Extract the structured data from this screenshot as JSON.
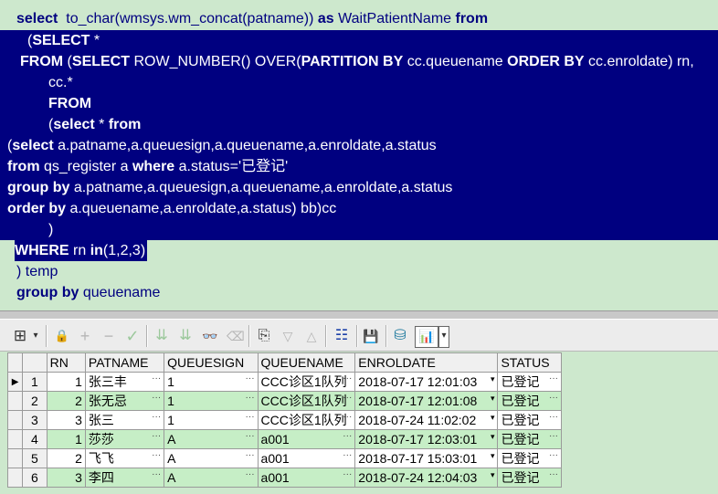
{
  "sql": {
    "l1": {
      "kw1": "select",
      "t1": "  to_char(wmsys.wm_concat(patname)) ",
      "kw2": "as",
      "t2": " WaitPatientName ",
      "kw3": "from"
    },
    "l2": {
      "t0": "(",
      "kw1": "SELECT",
      "t1": " *"
    },
    "l3": {
      "kw1": "FROM",
      "t1": " (",
      "kw2": "SELECT",
      "t2": " ROW_NUMBER() OVER(",
      "kw3": "PARTITION BY",
      "t3": " cc.queuename ",
      "kw4": "ORDER BY",
      "t4": " cc.enroldate) rn,"
    },
    "l4": {
      "t1": "cc.*"
    },
    "l5": {
      "kw1": "FROM"
    },
    "l6": {
      "t1": "(",
      "kw1": "select",
      "t2": " * ",
      "kw2": "from"
    },
    "l7": {
      "t0": "(",
      "kw1": "select",
      "t1": " a.patname,a.queuesign,a.queuename,a.enroldate,a.status"
    },
    "l8": {
      "kw1": "from",
      "t1": " qs_register a ",
      "kw2": "where",
      "t2": " a.status=",
      "s1": "'已登记'"
    },
    "l9": {
      "kw1": "group by",
      "t1": " a.patname,a.queuesign,a.queuename,a.enroldate,a.status"
    },
    "l10": {
      "kw1": "order by",
      "t1": " a.queuename,a.enroldate,a.status) bb)cc"
    },
    "l11": {
      "t1": ")"
    },
    "l12": {
      "kw1": "WHERE",
      "t1": " rn ",
      "kw2": "in",
      "t2": "(1,2,3)"
    },
    "l13": {
      "t1": ") temp"
    },
    "l14": {
      "kw1": "group by",
      "t1": " queuename"
    }
  },
  "grid": {
    "columns": [
      "RN",
      "PATNAME",
      "QUEUESIGN",
      "QUEUENAME",
      "ENROLDATE",
      "STATUS"
    ],
    "rows": [
      {
        "no": "1",
        "rn": "1",
        "patname": "张三丰",
        "queuesign": "1",
        "queuename": "CCC诊区1队列",
        "enroldate": "2018-07-17 12:01:03",
        "status": "已登记"
      },
      {
        "no": "2",
        "rn": "2",
        "patname": "张无忌",
        "queuesign": "1",
        "queuename": "CCC诊区1队列",
        "enroldate": "2018-07-17 12:01:08",
        "status": "已登记"
      },
      {
        "no": "3",
        "rn": "3",
        "patname": "张三",
        "queuesign": "1",
        "queuename": "CCC诊区1队列",
        "enroldate": "2018-07-24 11:02:02",
        "status": "已登记"
      },
      {
        "no": "4",
        "rn": "1",
        "patname": "莎莎",
        "queuesign": "A",
        "queuename": "a001",
        "enroldate": "2018-07-17 12:03:01",
        "status": "已登记"
      },
      {
        "no": "5",
        "rn": "2",
        "patname": "飞飞",
        "queuesign": "A",
        "queuename": "a001",
        "enroldate": "2018-07-17 15:03:01",
        "status": "已登记"
      },
      {
        "no": "6",
        "rn": "3",
        "patname": "李四",
        "queuesign": "A",
        "queuename": "a001",
        "enroldate": "2018-07-24 12:04:03",
        "status": "已登记"
      }
    ],
    "current_row_marker": "▶",
    "ellipsis": "···",
    "dropdown": "▾"
  },
  "toolbar": {
    "grid_icon": "⊞",
    "lock_icon": "🔒",
    "add_icon": "+",
    "remove_icon": "−",
    "check_icon": "✓",
    "filter_down_icon": "⇊",
    "filter_icon": "⇊",
    "find_icon": "👓",
    "clear_icon": "⌫",
    "export_icon": "⎘",
    "sort_down_icon": "▽",
    "sort_up_icon": "△",
    "tree_icon": "☷",
    "save_icon": "💾",
    "db_icon": "⛁",
    "chart_icon": "📊",
    "chevron_icon": "▾"
  }
}
